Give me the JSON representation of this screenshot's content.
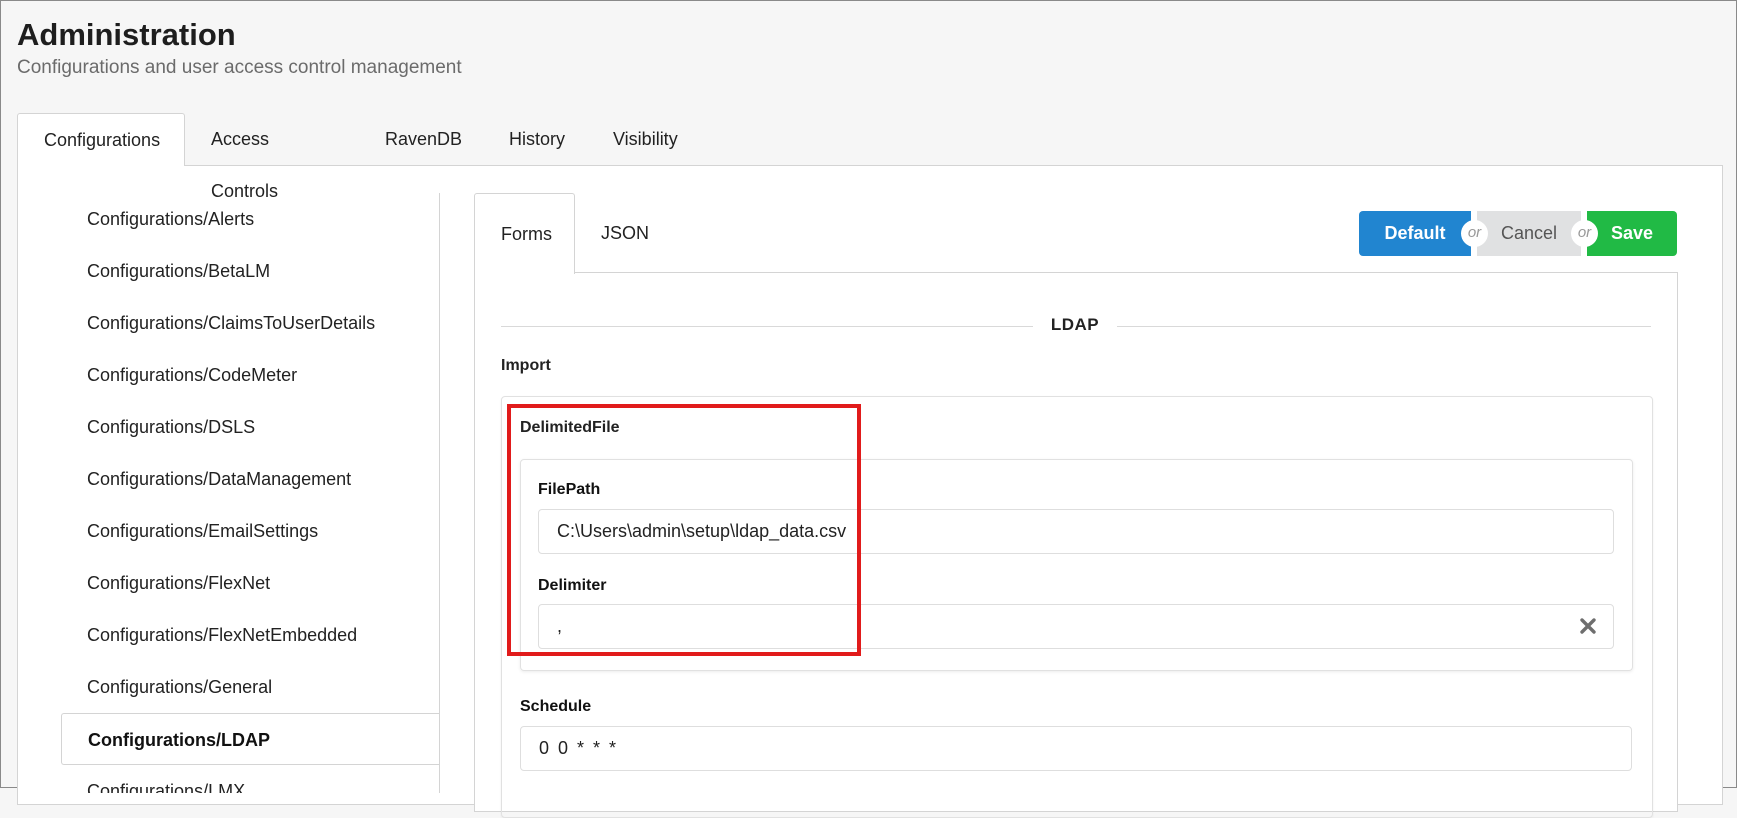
{
  "header": {
    "title": "Administration",
    "subtitle": "Configurations and user access control management"
  },
  "main_tabs": [
    {
      "label": "Configurations",
      "active": true
    },
    {
      "label": "Access Controls",
      "active": false
    },
    {
      "label": "RavenDB",
      "active": false
    },
    {
      "label": "History",
      "active": false
    },
    {
      "label": "Visibility",
      "active": false
    }
  ],
  "sidebar": {
    "items": [
      {
        "label": "Configurations/Alerts"
      },
      {
        "label": "Configurations/BetaLM"
      },
      {
        "label": "Configurations/ClaimsToUserDetails"
      },
      {
        "label": "Configurations/CodeMeter"
      },
      {
        "label": "Configurations/DSLS"
      },
      {
        "label": "Configurations/DataManagement"
      },
      {
        "label": "Configurations/EmailSettings"
      },
      {
        "label": "Configurations/FlexNet"
      },
      {
        "label": "Configurations/FlexNetEmbedded"
      },
      {
        "label": "Configurations/General"
      },
      {
        "label": "Configurations/LDAP",
        "active": true
      },
      {
        "label": "Configurations/LMX"
      }
    ]
  },
  "sub_tabs": [
    {
      "label": "Forms",
      "active": true
    },
    {
      "label": "JSON",
      "active": false
    }
  ],
  "actions": {
    "default_label": "Default",
    "or_label": "or",
    "cancel_label": "Cancel",
    "save_label": "Save"
  },
  "form": {
    "section_title": "LDAP",
    "import_label": "Import",
    "delimited_file_label": "DelimitedFile",
    "filepath_label": "FilePath",
    "filepath_value": "C:\\Users\\admin\\setup\\ldap_data.csv",
    "delimiter_label": "Delimiter",
    "delimiter_value": ",",
    "schedule_label": "Schedule",
    "schedule_value": "0 0 * * *"
  },
  "colors": {
    "primary": "#2185d0",
    "save": "#21ba45",
    "cancel": "#e0e1e2",
    "highlight": "#e11b1b"
  },
  "icons": {
    "clear": "close-icon"
  }
}
